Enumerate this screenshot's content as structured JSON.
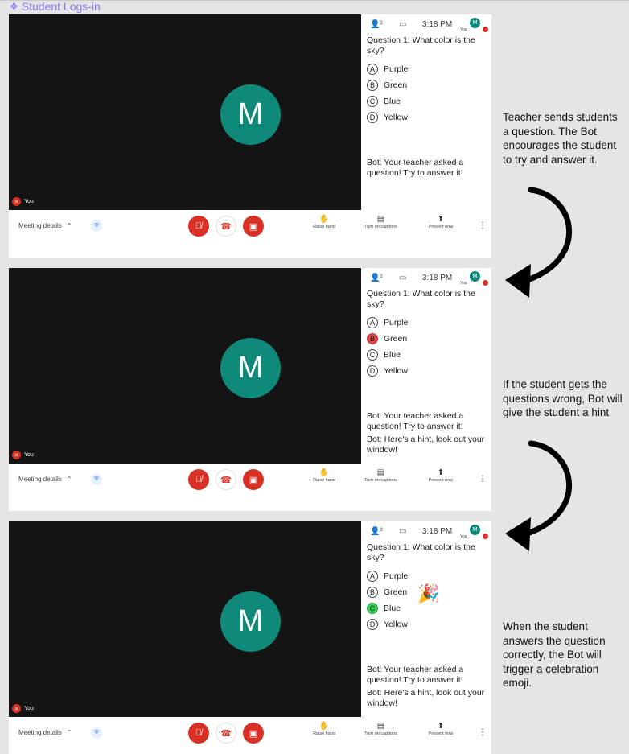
{
  "frame": {
    "title": "Student Logs-in",
    "icon": "component-icon"
  },
  "panels": [
    {
      "avatar_letter": "M",
      "you_label": "You",
      "clock": "3:18 PM",
      "self_label": "You",
      "self_avatar": "M",
      "question": "Question 1: What color is the sky?",
      "options": [
        {
          "letter": "A",
          "label": "Purple",
          "state": "normal"
        },
        {
          "letter": "B",
          "label": "Green",
          "state": "normal"
        },
        {
          "letter": "C",
          "label": "Blue",
          "state": "normal"
        },
        {
          "letter": "D",
          "label": "Yellow",
          "state": "normal"
        }
      ],
      "bot_messages": [
        "Bot: Your teacher asked a question! Try to answer it!"
      ],
      "annotation": "Teacher sends students a question. The Bot encourages the student to try and answer it."
    },
    {
      "avatar_letter": "M",
      "you_label": "You",
      "clock": "3:18 PM",
      "self_label": "You",
      "self_avatar": "M",
      "question": "Question 1: What color is the sky?",
      "options": [
        {
          "letter": "A",
          "label": "Purple",
          "state": "normal"
        },
        {
          "letter": "B",
          "label": "Green",
          "state": "wrong"
        },
        {
          "letter": "C",
          "label": "Blue",
          "state": "normal"
        },
        {
          "letter": "D",
          "label": "Yellow",
          "state": "normal"
        }
      ],
      "bot_messages": [
        "Bot: Your teacher asked a question! Try to answer it!",
        "Bot: Here's a hint, look out your window!"
      ],
      "annotation": "If the student gets the questions wrong, Bot will give the student a hint"
    },
    {
      "avatar_letter": "M",
      "you_label": "You",
      "clock": "3:18 PM",
      "self_label": "You",
      "self_avatar": "M",
      "question": "Question 1: What color is the sky?",
      "options": [
        {
          "letter": "A",
          "label": "Purple",
          "state": "normal"
        },
        {
          "letter": "B",
          "label": "Green",
          "state": "normal"
        },
        {
          "letter": "C",
          "label": "Blue",
          "state": "correct"
        },
        {
          "letter": "D",
          "label": "Yellow",
          "state": "normal"
        }
      ],
      "bot_messages": [
        "Bot: Your teacher asked a question! Try to answer it!",
        "Bot: Here's a hint, look out your window!"
      ],
      "celebration": "🎉",
      "annotation": "When the student answers the question correctly, the Bot will trigger a celebration emoji."
    }
  ],
  "controls": {
    "meeting_details": "Meeting details",
    "raise_hand": "Raise hand",
    "captions": "Turn on captions",
    "present": "Present now"
  },
  "colors": {
    "mute_red": "#d93025",
    "avatar_teal": "#0f8a7a",
    "wrong": "#e04a4a",
    "correct": "#3cd35a",
    "frame_title": "#8a7cf6"
  }
}
